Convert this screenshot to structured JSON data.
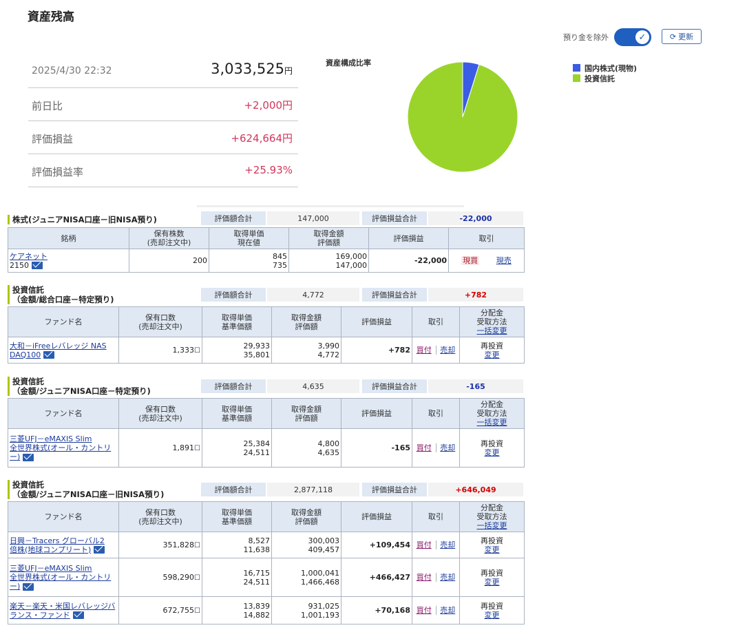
{
  "page": {
    "title": "資産残高"
  },
  "toolbar": {
    "exclude_deposit_label": "預り金を除外",
    "refresh_label": "更新"
  },
  "summary": {
    "datetime": "2025/4/30 22:32",
    "total_value": "3,033,525",
    "total_unit": "円",
    "rows": [
      {
        "label": "前日比",
        "value": "+2,000円"
      },
      {
        "label": "評価損益",
        "value": "+624,664円"
      },
      {
        "label": "評価損益率",
        "value": "+25.93%"
      }
    ]
  },
  "chart_data": {
    "type": "pie",
    "title": "資産構成比率",
    "legend": "top-right",
    "slices": [
      {
        "label": "国内株式(現物)",
        "value": 147000,
        "color": "#3b5ce4"
      },
      {
        "label": "投資信託",
        "value": 2886525,
        "color": "#9ad42a"
      }
    ]
  },
  "common": {
    "total_label": "評価額合計",
    "pl_total_label": "評価損益合計"
  },
  "stocks": {
    "title": "株式(ジュニアNISA口座－旧NISA預り)",
    "total_value": "147,000",
    "pl_total": "-22,000",
    "headers": {
      "name": "銘柄",
      "qty_1": "保有株数",
      "qty_2": "(売却注文中)",
      "cost_1": "取得単価",
      "cost_2": "現在値",
      "amt_1": "取得金額",
      "amt_2": "評価額",
      "pl": "評価損益",
      "trade": "取引"
    },
    "rows": [
      {
        "name": "ケアネット",
        "code": "2150",
        "qty": "200",
        "cost": "845",
        "price": "735",
        "acq_amount": "169,000",
        "eval_amount": "147,000",
        "pl": "-22,000",
        "buy": "現買",
        "sell": "現売"
      }
    ]
  },
  "fund_headers": {
    "name": "ファンド名",
    "qty_1": "保有口数",
    "qty_2": "(売却注文中)",
    "cost_1": "取得単価",
    "cost_2": "基準価額",
    "amt_1": "取得金額",
    "amt_2": "評価額",
    "pl": "評価損益",
    "trade": "取引",
    "dist_1": "分配金",
    "dist_2": "受取方法",
    "dist_3": "一括変更"
  },
  "funds": [
    {
      "title_1": "投資信託",
      "title_2": "（金額/総合口座－特定預り)",
      "total_value": "4,772",
      "pl_total": "+782",
      "rows": [
        {
          "name_1": "大和－iFreeレバレッジ NAS",
          "name_2": "DAQ100",
          "name_3": "",
          "qty": "1,333",
          "cost": "29,933",
          "nav": "35,801",
          "acq_amount": "3,990",
          "eval_amount": "4,772",
          "pl": "+782",
          "buy": "買付",
          "sell": "売却",
          "dist_1": "再投資",
          "dist_2": "変更"
        }
      ]
    },
    {
      "title_1": "投資信託",
      "title_2": "（金額/ジュニアNISA口座－特定預り)",
      "total_value": "4,635",
      "pl_total": "-165",
      "rows": [
        {
          "name_1": "三菱UFJ－eMAXIS Slim",
          "name_2": "全世界株式(オール・カントリ",
          "name_3": "ー)",
          "qty": "1,891",
          "cost": "25,384",
          "nav": "24,511",
          "acq_amount": "4,800",
          "eval_amount": "4,635",
          "pl": "-165",
          "buy": "買付",
          "sell": "売却",
          "dist_1": "再投資",
          "dist_2": "変更"
        }
      ]
    },
    {
      "title_1": "投資信託",
      "title_2": "（金額/ジュニアNISA口座－旧NISA預り)",
      "total_value": "2,877,118",
      "pl_total": "+646,049",
      "rows": [
        {
          "name_1": "日興－Tracers グローバル2",
          "name_2": "倍株(地球コンプリート)",
          "name_3": "",
          "qty": "351,828",
          "cost": "8,527",
          "nav": "11,638",
          "acq_amount": "300,003",
          "eval_amount": "409,457",
          "pl": "+109,454",
          "buy": "買付",
          "sell": "売却",
          "dist_1": "再投資",
          "dist_2": "変更"
        },
        {
          "name_1": "三菱UFJ－eMAXIS Slim",
          "name_2": "全世界株式(オール・カントリ",
          "name_3": "ー)",
          "qty": "598,290",
          "cost": "16,715",
          "nav": "24,511",
          "acq_amount": "1,000,041",
          "eval_amount": "1,466,468",
          "pl": "+466,427",
          "buy": "買付",
          "sell": "売却",
          "dist_1": "再投資",
          "dist_2": "変更"
        },
        {
          "name_1": "楽天－楽天・米国レバレッジバ",
          "name_2": "ランス・ファンド",
          "name_3": "",
          "qty": "672,755",
          "cost": "13,839",
          "nav": "14,882",
          "acq_amount": "931,025",
          "eval_amount": "1,001,193",
          "pl": "+70,168",
          "buy": "買付",
          "sell": "売却",
          "dist_1": "再投資",
          "dist_2": "変更"
        }
      ]
    }
  ]
}
